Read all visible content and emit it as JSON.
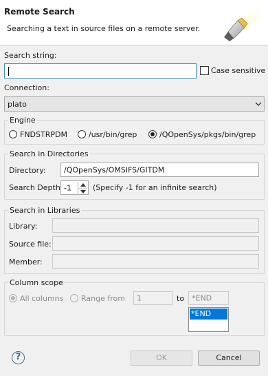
{
  "header": {
    "title": "Remote Search",
    "subtitle": "Searching a text in source files on a remote server."
  },
  "search": {
    "label": "Search string:",
    "value": "",
    "case_sensitive_label": "Case sensitive",
    "case_sensitive_checked": false
  },
  "connection": {
    "label": "Connection:",
    "value": "plato"
  },
  "engine": {
    "legend": "Engine",
    "options": [
      "FNDSTRPDM",
      "/usr/bin/grep",
      "/QOpenSys/pkgs/bin/grep"
    ],
    "selected": "/QOpenSys/pkgs/bin/grep"
  },
  "directories": {
    "legend": "Search in Directories",
    "directory_label": "Directory:",
    "directory_value": "/QOpenSys/OMSIFS/GITDM",
    "depth_label": "Search Depth",
    "depth_value": "-1",
    "depth_hint": "(Specify -1 for an infinite search)"
  },
  "libraries": {
    "legend": "Search in Libraries",
    "library_label": "Library:",
    "source_file_label": "Source file:",
    "member_label": "Member:"
  },
  "column_scope": {
    "legend": "Column scope",
    "all_columns_label": "All columns",
    "range_from_label": "Range from",
    "from_value": "1",
    "to_label": "to",
    "to_value": "*END",
    "dropdown_selected": "*END"
  },
  "buttons": {
    "ok": "OK",
    "cancel": "Cancel",
    "help": "?"
  },
  "colors": {
    "accent": "#0078d7",
    "focus_border": "#3c8fbf"
  }
}
